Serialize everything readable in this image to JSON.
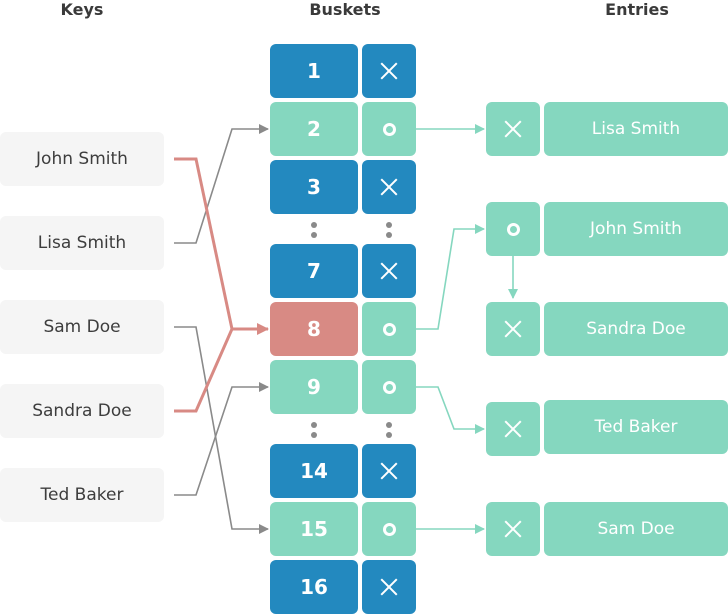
{
  "headers": {
    "keys": "Keys",
    "buckets": "Buskets",
    "entries": "Entries"
  },
  "keys": [
    {
      "label": "John Smith"
    },
    {
      "label": "Lisa Smith"
    },
    {
      "label": "Sam Doe"
    },
    {
      "label": "Sandra Doe"
    },
    {
      "label": "Ted Baker"
    }
  ],
  "buckets": [
    {
      "index": "1",
      "state": "empty"
    },
    {
      "index": "2",
      "state": "used"
    },
    {
      "index": "3",
      "state": "empty"
    },
    {
      "index": "7",
      "state": "empty"
    },
    {
      "index": "8",
      "state": "collision"
    },
    {
      "index": "9",
      "state": "used"
    },
    {
      "index": "14",
      "state": "empty"
    },
    {
      "index": "15",
      "state": "used"
    },
    {
      "index": "16",
      "state": "empty"
    }
  ],
  "entries": [
    {
      "label": "Lisa Smith",
      "pointer": "null"
    },
    {
      "label": "John Smith",
      "pointer": "next"
    },
    {
      "label": "Sandra Doe",
      "pointer": "null"
    },
    {
      "label": "Ted Baker",
      "pointer": "null"
    },
    {
      "label": "Sam Doe",
      "pointer": "null"
    }
  ],
  "mapping": [
    {
      "key": "John Smith",
      "bucket": "8"
    },
    {
      "key": "Lisa Smith",
      "bucket": "2"
    },
    {
      "key": "Sam Doe",
      "bucket": "15"
    },
    {
      "key": "Sandra Doe",
      "bucket": "8"
    },
    {
      "key": "Ted Baker",
      "bucket": "9"
    }
  ],
  "colors": {
    "empty": "#2389bf",
    "used": "#85d7bf",
    "collision": "#d88a84",
    "link": "#8a8a8a"
  }
}
